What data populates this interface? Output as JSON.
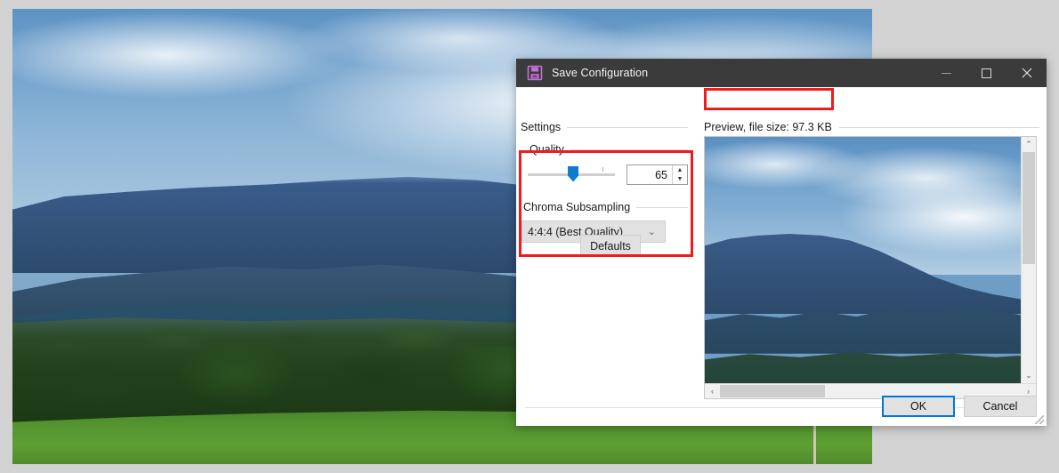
{
  "background": {
    "image_description": "mountain-landscape-photo"
  },
  "dialog": {
    "title": "Save Configuration",
    "title_icon": "save-floppy-icon",
    "window_controls": {
      "minimize": "minimize-icon",
      "maximize": "maximize-icon",
      "close": "close-icon"
    },
    "settings": {
      "group_label": "Settings",
      "quality": {
        "label": "Quality",
        "value": "65",
        "slider_position_percent": 52,
        "spin_up": "▲",
        "spin_down": "▼"
      },
      "chroma": {
        "label": "Chroma Subsampling",
        "selected": "4:4:4 (Best Quality)",
        "chevron": "⌄"
      },
      "defaults_button": "Defaults"
    },
    "preview": {
      "label": "Preview, file size: 97.3 KB",
      "file_size": "97.3 KB",
      "vertical_scrollbar": {
        "up_arrow": "⌃",
        "down_arrow": "⌄"
      },
      "horizontal_scrollbar": {
        "left_arrow": "‹",
        "right_arrow": "›"
      }
    },
    "footer": {
      "ok_button": "OK",
      "cancel_button": "Cancel"
    }
  },
  "annotations": {
    "highlight_color": "#ee1c1c",
    "settings_box": "red-highlight-settings",
    "preview_box": "red-highlight-preview"
  },
  "colors": {
    "titlebar": "#3b3b3b",
    "accent": "#0078d7",
    "slider_thumb": "#0f7ad4",
    "desktop_background": "#d2d2d2"
  }
}
